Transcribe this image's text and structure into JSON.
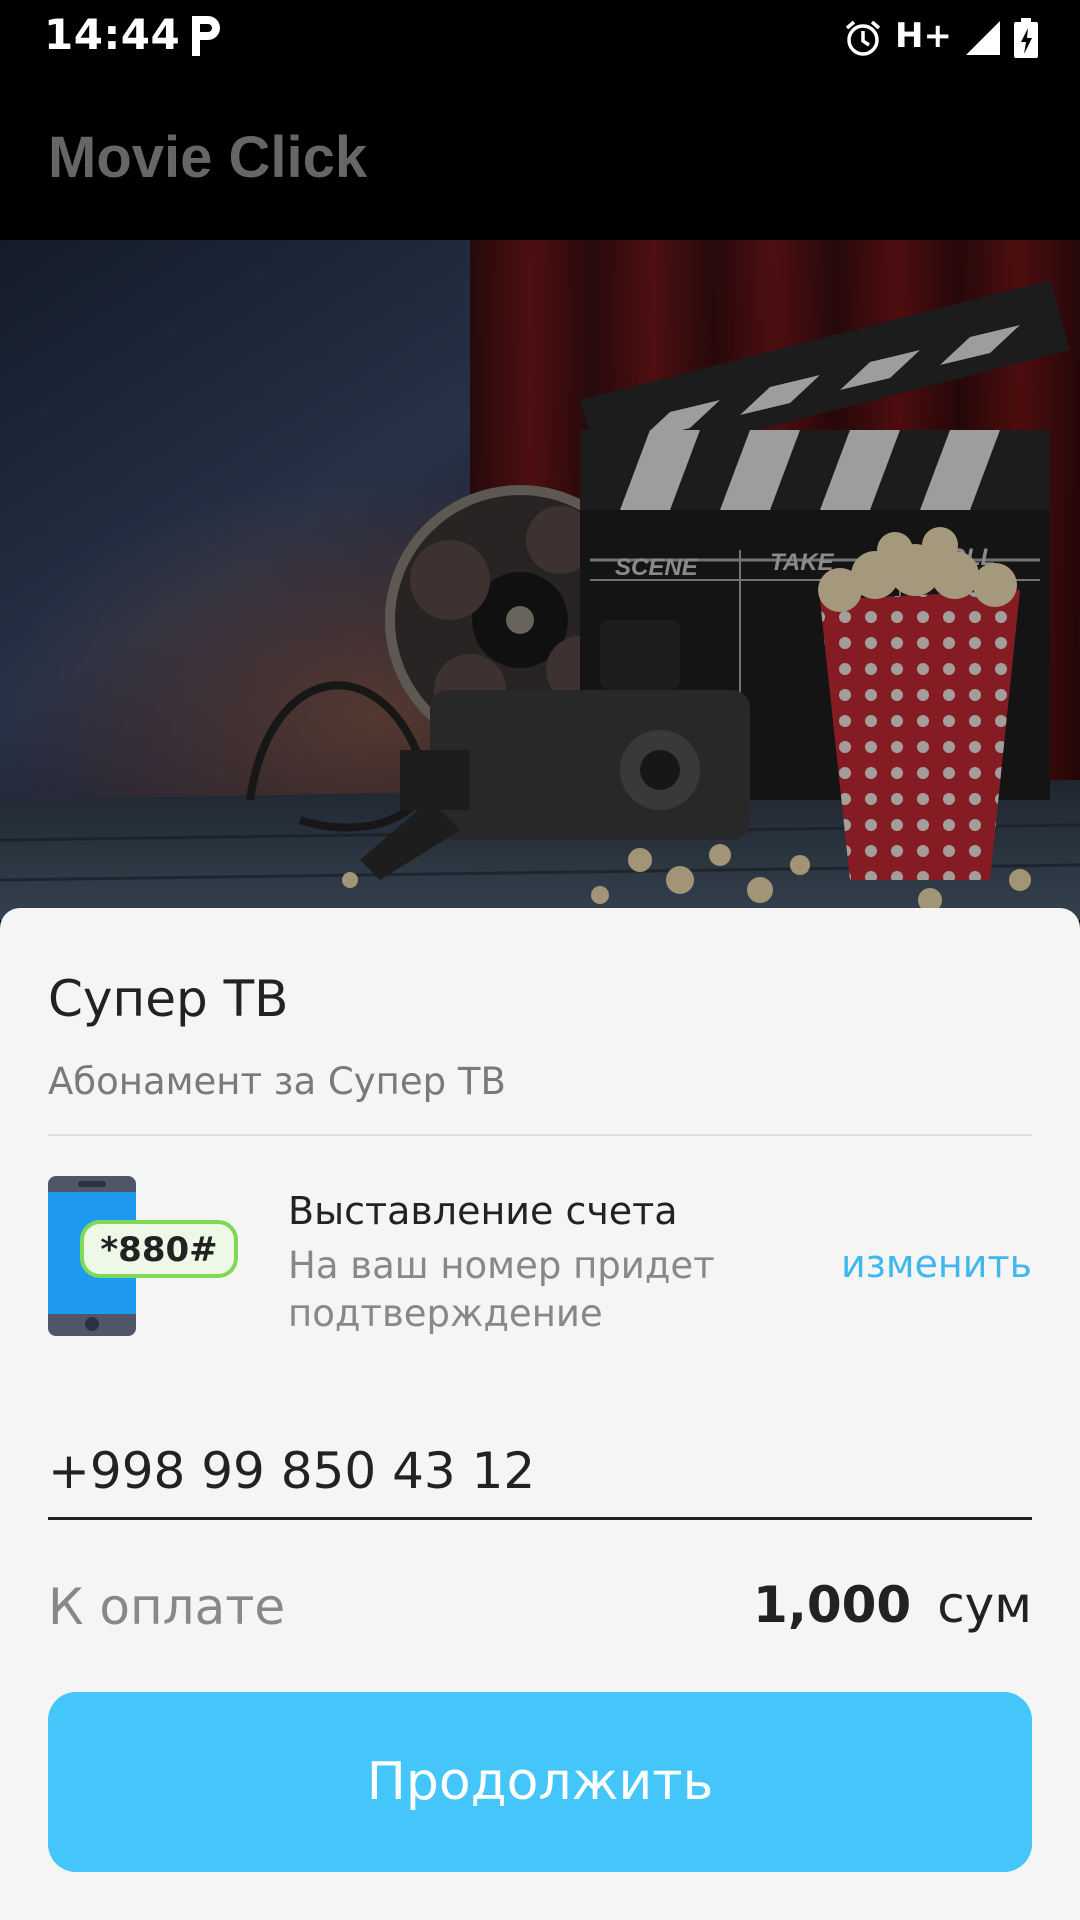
{
  "status_bar": {
    "time": "14:44",
    "network": "H+",
    "icons": [
      "parking-p-icon",
      "alarm-icon",
      "signal-icon",
      "battery-charging-icon"
    ]
  },
  "app": {
    "title": "Movie Click"
  },
  "hero": {
    "clapperboard_labels": [
      "SCENE",
      "TAKE",
      "ROLL"
    ]
  },
  "sheet": {
    "title": "Супер ТВ",
    "subtitle": "Абонамент за Супер ТВ",
    "billing": {
      "ussd_code": "*880#",
      "title": "Выставление счета",
      "description": "На ваш номер придет подтверждение",
      "change_label": "изменить"
    },
    "phone_number": "+998 99 850 43 12",
    "payment": {
      "label": "К оплате",
      "amount": "1,000",
      "currency": "сум"
    },
    "continue_label": "Продолжить"
  },
  "colors": {
    "accent": "#44c6fb",
    "link": "#3fb7ef",
    "sheet_bg": "#f5f5f5",
    "ussd_green": "#7ed957"
  }
}
